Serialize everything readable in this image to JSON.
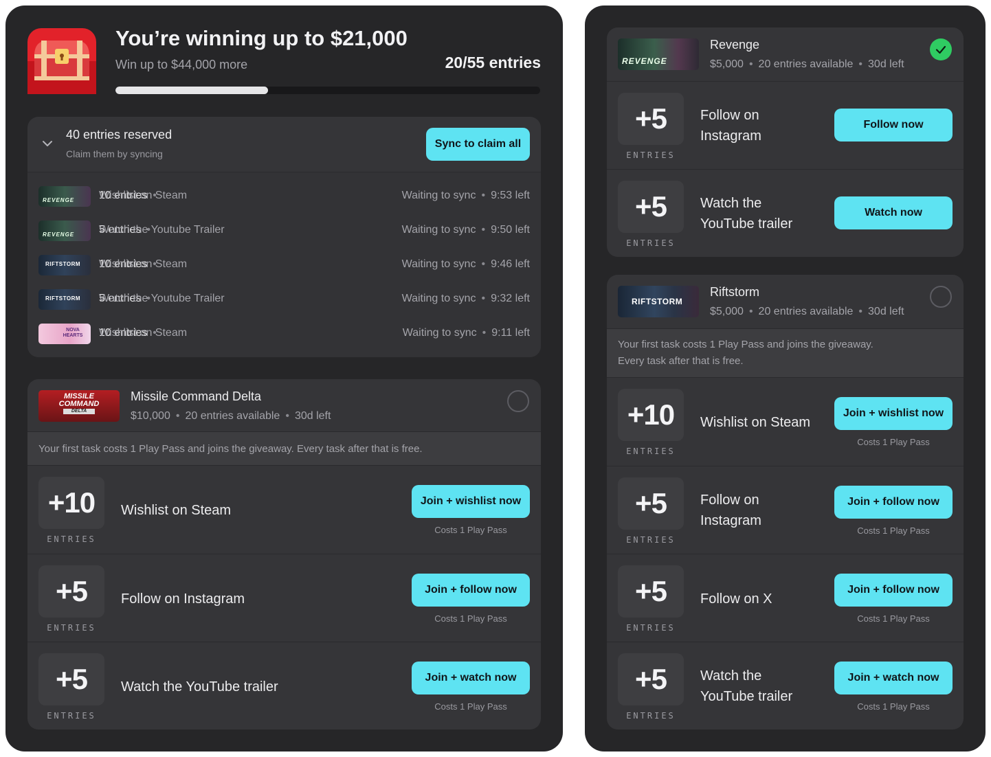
{
  "header": {
    "title": "You’re winning up to $21,000",
    "subtitle": "Win up to $44,000 more",
    "entries_count": "20/55 entries",
    "progress": 0.36
  },
  "reserved": {
    "title": "40 entries reserved",
    "subtitle": "Claim them by syncing",
    "sync_label": "Sync to claim all",
    "items": [
      {
        "entries": "10 entries",
        "task": "Wishlist on Steam",
        "status": "Waiting to sync",
        "time": "9:53 left",
        "game": "REVENGE"
      },
      {
        "entries": "5 entries",
        "task": "Watch the Youtube Trailer",
        "status": "Waiting to sync",
        "time": "9:50 left",
        "game": "REVENGE"
      },
      {
        "entries": "10 entries",
        "task": "Wishlist on Steam",
        "status": "Waiting to sync",
        "time": "9:46 left",
        "game": "RIFTSTORM"
      },
      {
        "entries": "5 entries",
        "task": "Watch the Youtube Trailer",
        "status": "Waiting to sync",
        "time": "9:32 left",
        "game": "RIFTSTORM"
      },
      {
        "entries": "10 entries",
        "task": "Wishlist on Steam",
        "status": "Waiting to sync",
        "time": "9:11 left",
        "game": "NOVA HEARTS"
      }
    ]
  },
  "missile": {
    "name": "Missile Command Delta",
    "prize": "$10,000",
    "available": "20 entries available",
    "left": "30d left",
    "logo": [
      "MISSILE",
      "COMMAND",
      "DELTA"
    ],
    "notice": "Your first task costs 1 Play Pass and joins the giveaway. Every task after that is free.",
    "tasks": [
      {
        "amount": "+10",
        "unit": "ENTRIES",
        "label": "Wishlist on Steam",
        "button": "Join + wishlist now",
        "cost": "Costs 1 Play Pass"
      },
      {
        "amount": "+5",
        "unit": "ENTRIES",
        "label": "Follow on Instagram",
        "button": "Join + follow now",
        "cost": "Costs 1 Play Pass"
      },
      {
        "amount": "+5",
        "unit": "ENTRIES",
        "label": "Watch the YouTube trailer",
        "button": "Join + watch now",
        "cost": "Costs 1 Play Pass"
      }
    ]
  },
  "revenge": {
    "name": "Revenge",
    "prize": "$5,000",
    "available": "20 entries available",
    "left": "30d left",
    "logo": "REVENGE",
    "tasks": [
      {
        "amount": "+5",
        "unit": "ENTRIES",
        "label1": "Follow on",
        "label2": "Instagram",
        "button": "Follow now"
      },
      {
        "amount": "+5",
        "unit": "ENTRIES",
        "label1": "Watch the",
        "label2": "YouTube trailer",
        "button": "Watch now"
      }
    ]
  },
  "riftstorm": {
    "name": "Riftstorm",
    "prize": "$5,000",
    "available": "20 entries available",
    "left": "30d left",
    "logo": "RIFTSTORM",
    "notice1": "Your first task costs 1 Play Pass and joins the giveaway.",
    "notice2": "Every task after that is free.",
    "tasks": [
      {
        "amount": "+10",
        "unit": "ENTRIES",
        "label1": "Wishlist on Steam",
        "label2": "",
        "button": "Join + wishlist now",
        "cost": "Costs 1 Play Pass"
      },
      {
        "amount": "+5",
        "unit": "ENTRIES",
        "label1": "Follow on",
        "label2": "Instagram",
        "button": "Join + follow now",
        "cost": "Costs 1 Play Pass"
      },
      {
        "amount": "+5",
        "unit": "ENTRIES",
        "label1": "Follow on X",
        "label2": "",
        "button": "Join + follow now",
        "cost": "Costs 1 Play Pass"
      },
      {
        "amount": "+5",
        "unit": "ENTRIES",
        "label1": "Watch the",
        "label2": "YouTube trailer",
        "button": "Join + watch now",
        "cost": "Costs 1 Play Pass"
      }
    ]
  },
  "colors": {
    "accent": "#5ee3f2",
    "success": "#2fcc62",
    "panel": "#262628",
    "card": "#353538"
  }
}
